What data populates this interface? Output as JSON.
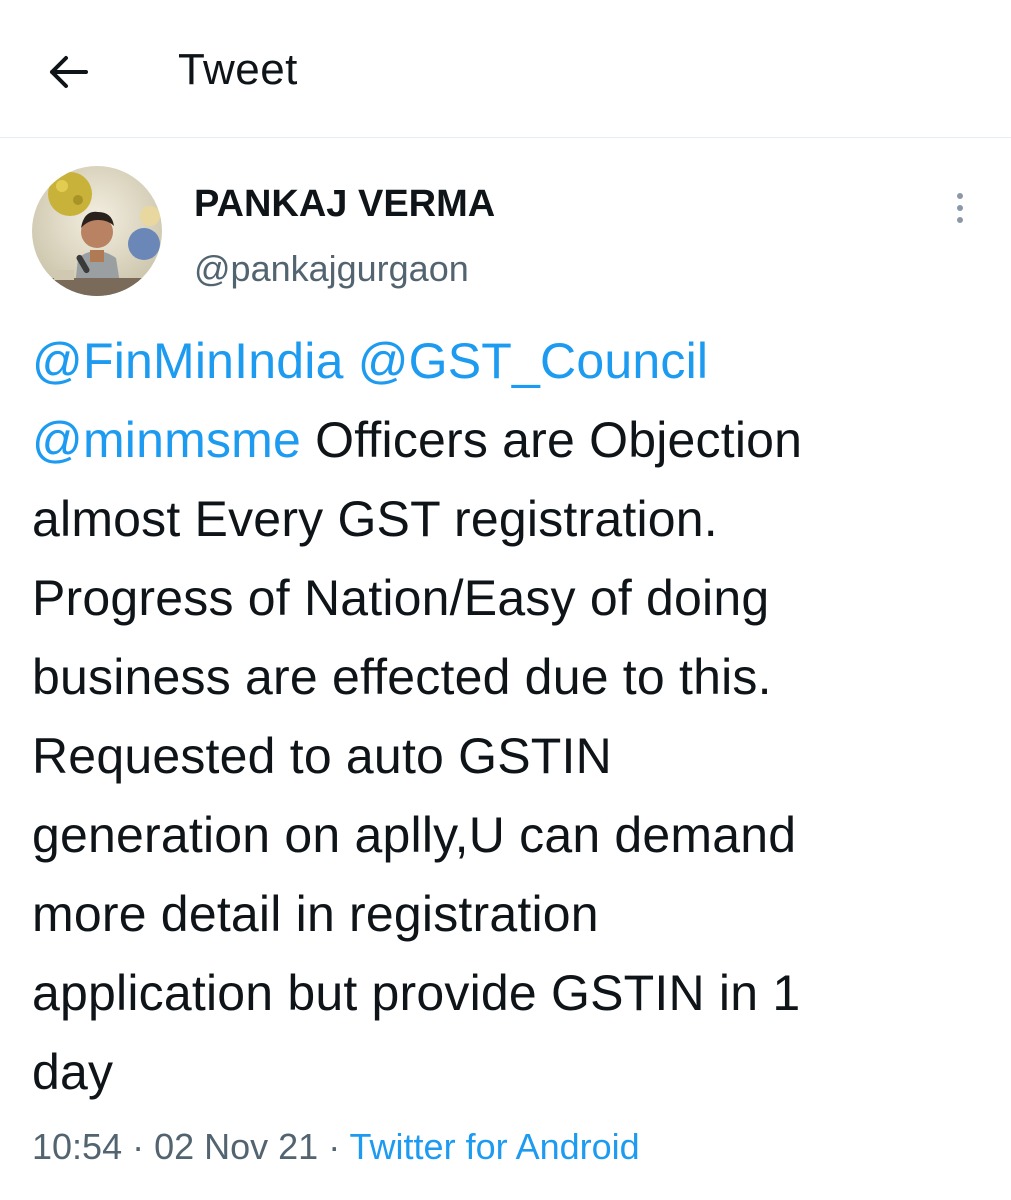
{
  "header": {
    "back_icon": "arrow-left-icon",
    "title": "Tweet"
  },
  "author": {
    "name": "PANKAJ VERMA",
    "handle": "@pankajgurgaon",
    "more_icon": "more-vertical-icon"
  },
  "tweet": {
    "lines": [
      {
        "mention": "@FinMinIndia @GST_Council",
        "text": ""
      },
      {
        "mention": "@minmsme",
        "text": " Officers are Objection"
      },
      {
        "mention": "",
        "text": "almost Every GST registration."
      },
      {
        "mention": "",
        "text": "Progress of Nation/Easy of doing"
      },
      {
        "mention": "",
        "text": "business are effected due to this."
      },
      {
        "mention": "",
        "text": "Requested to auto GSTIN"
      },
      {
        "mention": "",
        "text": "generation on aplly,U can demand"
      },
      {
        "mention": "",
        "text": "more detail in registration"
      },
      {
        "mention": "",
        "text": "application but provide GSTIN in 1"
      },
      {
        "mention": "",
        "text": "day"
      }
    ]
  },
  "meta": {
    "time": "10:54",
    "separator": " · ",
    "date": "02 Nov 21",
    "source": "Twitter for Android"
  },
  "colors": {
    "accent": "#1d9bf0",
    "text": "#0f1419",
    "muted": "#536471"
  }
}
